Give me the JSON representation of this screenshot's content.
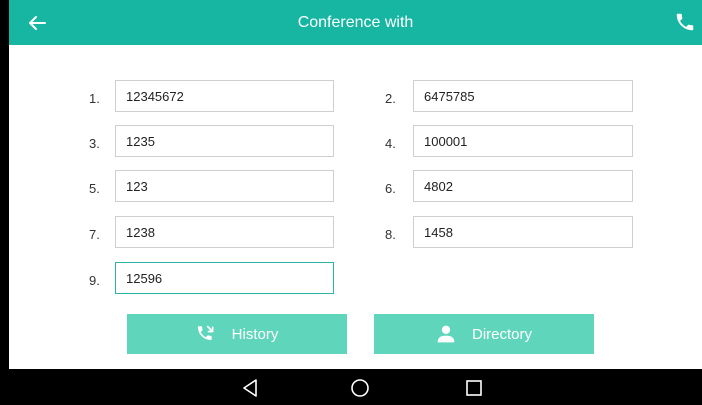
{
  "header": {
    "title": "Conference with"
  },
  "fields": [
    {
      "label": "1.",
      "value": "12345672"
    },
    {
      "label": "2.",
      "value": "6475785"
    },
    {
      "label": "3.",
      "value": "1235"
    },
    {
      "label": "4.",
      "value": "100001"
    },
    {
      "label": "5.",
      "value": "123"
    },
    {
      "label": "6.",
      "value": "4802"
    },
    {
      "label": "7.",
      "value": "1238"
    },
    {
      "label": "8.",
      "value": "1458"
    },
    {
      "label": "9.",
      "value": "12596"
    }
  ],
  "buttons": {
    "history_label": "History",
    "directory_label": "Directory"
  },
  "icons": {
    "back": "back-arrow-icon",
    "call": "phone-icon",
    "history": "call-history-icon",
    "directory": "person-icon",
    "nav_back": "nav-back-icon",
    "nav_home": "nav-home-icon",
    "nav_recent": "nav-recent-icon"
  },
  "colors": {
    "titlebar": "#16b6a3",
    "button": "#5fd6bb",
    "active_border": "#2bb3a8"
  }
}
